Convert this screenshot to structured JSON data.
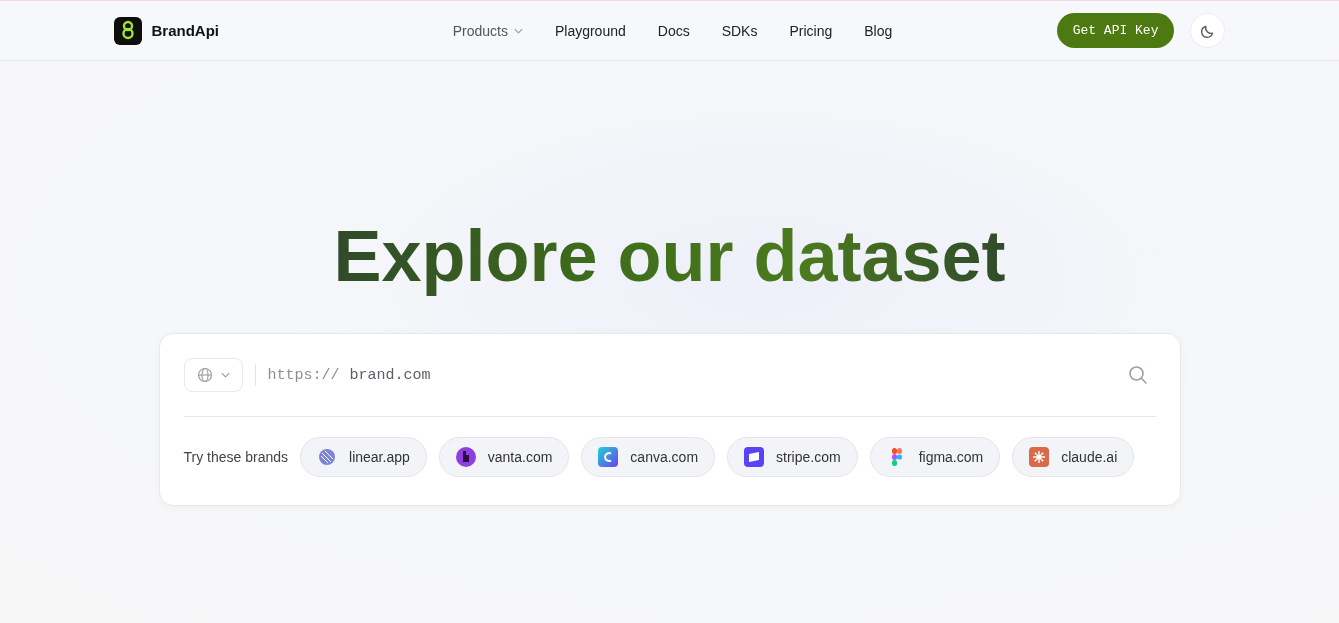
{
  "header": {
    "brand": "BrandApi",
    "nav": [
      {
        "label": "Products",
        "dropdown": true
      },
      {
        "label": "Playground",
        "dropdown": false
      },
      {
        "label": "Docs",
        "dropdown": false
      },
      {
        "label": "SDKs",
        "dropdown": false
      },
      {
        "label": "Pricing",
        "dropdown": false
      },
      {
        "label": "Blog",
        "dropdown": false
      }
    ],
    "cta": "Get API Key"
  },
  "hero": {
    "title": "Explore our dataset"
  },
  "search": {
    "prefix": "https://",
    "placeholder": "brand.com"
  },
  "suggestions": {
    "label": "Try these brands",
    "brands": [
      {
        "name": "linear.app",
        "kind": "linear"
      },
      {
        "name": "vanta.com",
        "kind": "vanta"
      },
      {
        "name": "canva.com",
        "kind": "canva"
      },
      {
        "name": "stripe.com",
        "kind": "stripe"
      },
      {
        "name": "figma.com",
        "kind": "figma"
      },
      {
        "name": "claude.ai",
        "kind": "claude"
      }
    ]
  }
}
